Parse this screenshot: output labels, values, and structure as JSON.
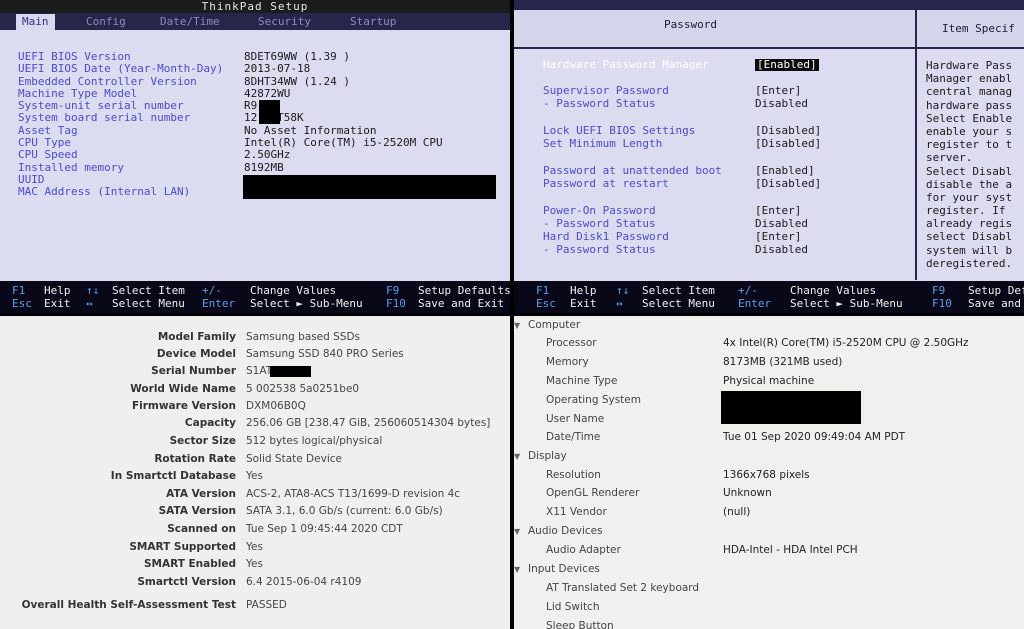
{
  "bios_main": {
    "title": "ThinkPad Setup",
    "tabs": [
      "Main",
      "Config",
      "Date/Time",
      "Security",
      "Startup"
    ],
    "rows": [
      {
        "label": "UEFI BIOS Version",
        "value": "8DET69WW (1.39 )"
      },
      {
        "label": "UEFI BIOS Date (Year-Month-Day)",
        "value": "2013-07-18"
      },
      {
        "label": "Embedded Controller Version",
        "value": "8DHT34WW (1.24 )"
      },
      {
        "label": "Machine Type Model",
        "value": "42872WU"
      },
      {
        "label": "System-unit serial number",
        "value": "R9      DA"
      },
      {
        "label": "System board serial number",
        "value": "12      15T58K"
      },
      {
        "label": "Asset Tag",
        "value": "No Asset Information"
      },
      {
        "label": "CPU Type",
        "value": "Intel(R) Core(TM) i5-2520M CPU"
      },
      {
        "label": "CPU Speed",
        "value": "2.50GHz"
      },
      {
        "label": "Installed memory",
        "value": "8192MB"
      },
      {
        "label": "UUID",
        "value": ""
      },
      {
        "label": "MAC Address (Internal LAN)",
        "value": ""
      }
    ]
  },
  "statusbar_left": {
    "row1": [
      {
        "k": "F1",
        "t": "Help"
      },
      {
        "k": "↑↓",
        "t": "Select Item"
      },
      {
        "k": "+/-",
        "t": "Change Values"
      },
      {
        "k": "F9",
        "t": "Setup Defaults"
      }
    ],
    "row2": [
      {
        "k": "Esc",
        "t": "Exit"
      },
      {
        "k": "↔",
        "t": "Select Menu"
      },
      {
        "k": "Enter",
        "t": "Select ► Sub-Menu"
      },
      {
        "k": "F10",
        "t": "Save and Exit"
      }
    ]
  },
  "bios_password": {
    "title": "Password",
    "help_title": "Item Specif",
    "rows": [
      {
        "label": "Hardware Password Manager",
        "value": "[Enabled]"
      },
      {
        "label": "Supervisor Password",
        "value": "[Enter]"
      },
      {
        "label": " - Password Status",
        "value": "Disabled"
      },
      {
        "label": "Lock UEFI BIOS Settings",
        "value": "[Disabled]"
      },
      {
        "label": "Set Minimum Length",
        "value": "[Disabled]"
      },
      {
        "label": "Password at unattended boot",
        "value": "[Enabled]"
      },
      {
        "label": "Password at restart",
        "value": "[Disabled]"
      },
      {
        "label": "Power-On Password",
        "value": "[Enter]"
      },
      {
        "label": " - Password Status",
        "value": "Disabled"
      },
      {
        "label": "Hard Disk1 Password",
        "value": "[Enter]"
      },
      {
        "label": " - Password Status",
        "value": "Disabled"
      }
    ],
    "help_lines": [
      "Hardware Pass",
      "Manager enabl",
      "central manag",
      "hardware pass",
      "Select Enable",
      "enable your s",
      "register to t",
      "server.",
      "Select Disabl",
      "disable the a",
      "for your syst",
      "register. If",
      "already regis",
      "select Disabl",
      "system will b",
      "deregistered."
    ]
  },
  "statusbar_right": {
    "row1": [
      {
        "k": "F1",
        "t": "Help"
      },
      {
        "k": "↑↓",
        "t": "Select Item"
      },
      {
        "k": "+/-",
        "t": "Change Values"
      },
      {
        "k": "F9",
        "t": "Setup Def"
      }
    ],
    "row2": [
      {
        "k": "Esc",
        "t": "Exit"
      },
      {
        "k": "↔",
        "t": "Select Menu"
      },
      {
        "k": "Enter",
        "t": "Select ► Sub-Menu"
      },
      {
        "k": "F10",
        "t": "Save and"
      }
    ]
  },
  "smartctl": [
    {
      "label": "Model Family",
      "value": "Samsung based SSDs"
    },
    {
      "label": "Device Model",
      "value": "Samsung SSD 840 PRO Series"
    },
    {
      "label": "Serial Number",
      "value": "S1AT              545E"
    },
    {
      "label": "World Wide Name",
      "value": "5 002538 5a0251be0"
    },
    {
      "label": "Firmware Version",
      "value": "DXM06B0Q"
    },
    {
      "label": "Capacity",
      "value": "256.06 GB [238.47 GiB, 256060514304 bytes]"
    },
    {
      "label": "Sector Size",
      "value": "512 bytes logical/physical"
    },
    {
      "label": "Rotation Rate",
      "value": "Solid State Device"
    },
    {
      "label": "In Smartctl Database",
      "value": "Yes"
    },
    {
      "label": "ATA Version",
      "value": "ACS-2, ATA8-ACS T13/1699-D revision 4c"
    },
    {
      "label": "SATA Version",
      "value": "SATA 3.1, 6.0 Gb/s (current: 6.0 Gb/s)"
    },
    {
      "label": "Scanned on",
      "value": "Tue Sep  1 09:45:44 2020 CDT"
    },
    {
      "label": "SMART Supported",
      "value": "Yes"
    },
    {
      "label": "SMART Enabled",
      "value": "Yes"
    },
    {
      "label": "Smartctl Version",
      "value": "6.4 2015-06-04 r4109"
    },
    {
      "label": "Overall Health Self-Assessment Test",
      "value": "PASSED"
    }
  ],
  "sysinfo": {
    "computer": {
      "label": "Computer",
      "items": [
        {
          "label": "Processor",
          "value": "4x Intel(R) Core(TM) i5-2520M CPU @ 2.50GHz"
        },
        {
          "label": "Memory",
          "value": "8173MB (321MB used)"
        },
        {
          "label": "Machine Type",
          "value": "Physical machine"
        },
        {
          "label": "Operating System",
          "value": ""
        },
        {
          "label": "User Name",
          "value": ""
        },
        {
          "label": "Date/Time",
          "value": "Tue 01 Sep 2020 09:49:04 AM PDT"
        }
      ]
    },
    "display": {
      "label": "Display",
      "items": [
        {
          "label": "Resolution",
          "value": "1366x768 pixels"
        },
        {
          "label": "OpenGL Renderer",
          "value": "Unknown"
        },
        {
          "label": "X11 Vendor",
          "value": "(null)"
        }
      ]
    },
    "audio": {
      "label": "Audio Devices",
      "items": [
        {
          "label": "Audio Adapter",
          "value": "HDA-Intel - HDA Intel PCH"
        }
      ]
    },
    "input": {
      "label": "Input Devices",
      "items": [
        {
          "label": "AT Translated Set 2 keyboard",
          "value": ""
        },
        {
          "label": "Lid Switch",
          "value": ""
        },
        {
          "label": "Sleep Button",
          "value": ""
        }
      ]
    }
  }
}
